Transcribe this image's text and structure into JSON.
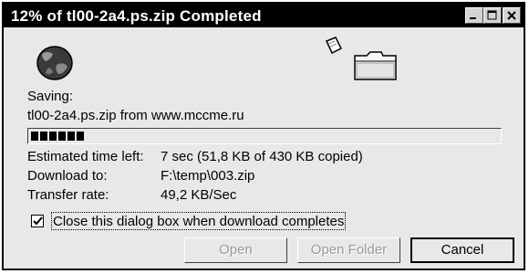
{
  "window": {
    "title": "12% of tl00-2a4.ps.zip Completed",
    "controls": {
      "minimize": "minimize-icon",
      "maximize": "maximize-icon",
      "close": "close-icon"
    }
  },
  "animation": {
    "icons": [
      "globe-icon",
      "flying-page-icon",
      "folder-icon"
    ]
  },
  "status": {
    "saving_label": "Saving:",
    "saving_source": "tl00-2a4.ps.zip from www.mccme.ru",
    "progress_percent": 12
  },
  "details": {
    "time_left_label": "Estimated time left:",
    "time_left_value": "7 sec (51,8 KB of 430 KB copied)",
    "download_to_label": "Download to:",
    "download_to_value": "F:\\temp\\003.zip",
    "transfer_rate_label": "Transfer rate:",
    "transfer_rate_value": "49,2 KB/Sec"
  },
  "options": {
    "close_when_done_label": "Close this dialog box when download completes",
    "close_when_done_checked": true
  },
  "buttons": {
    "open": "Open",
    "open_folder": "Open Folder",
    "cancel": "Cancel"
  }
}
